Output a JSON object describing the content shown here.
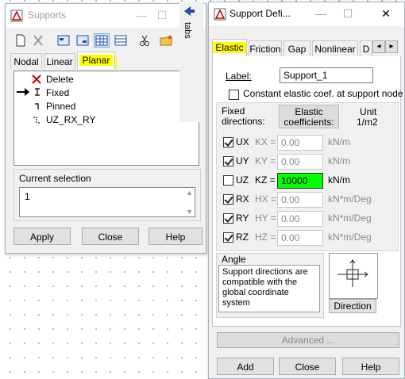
{
  "supports_window": {
    "title": "Supports",
    "minimize": "—",
    "maximize": "☐",
    "toolbar_icons": [
      "new-icon",
      "delete-icon",
      "view1-icon",
      "view2-icon",
      "table-icon",
      "grid-icon",
      "cut-icon",
      "folder-icon"
    ],
    "tabs": [
      "Nodal",
      "Linear",
      "Planar"
    ],
    "active_tab": "Planar",
    "items": [
      {
        "label": "Delete",
        "icon": "red-x-icon"
      },
      {
        "label": "Fixed",
        "icon": "fixed-support-icon"
      },
      {
        "label": "Pinned",
        "icon": "pinned-support-icon"
      },
      {
        "label": "UZ_RX_RY",
        "icon": "custom-support-icon"
      }
    ],
    "selected_index": 1,
    "current_selection_label": "Current selection",
    "current_selection_value": "1",
    "buttons": {
      "apply": "Apply",
      "close": "Close",
      "help": "Help"
    },
    "side_tab": "tabs"
  },
  "support_def_window": {
    "title": "Support Defi...",
    "minimize": "—",
    "maximize": "☐",
    "close": "✕",
    "tabs": [
      "Elastic",
      "Friction",
      "Gap",
      "Nonlinear",
      "D"
    ],
    "active_tab": "Elastic",
    "label_caption": "Label:",
    "label_value": "Support_1",
    "constant_elastic": "Constant elastic coef. at support node",
    "fixed_directions": "Fixed\ndirections:",
    "elastic_coefficients": "Elastic\ncoefficients:",
    "unit_header": "Unit",
    "unit_sub": "1/m2",
    "directions": [
      {
        "dir": "UX",
        "coef": "KX =",
        "value": "0.00",
        "unit": "kN/m",
        "checked": true,
        "enabled": false
      },
      {
        "dir": "UY",
        "coef": "KY =",
        "value": "0.00",
        "unit": "kN/m",
        "checked": true,
        "enabled": false
      },
      {
        "dir": "UZ",
        "coef": "KZ =",
        "value": "10000",
        "unit": "kN/m",
        "checked": false,
        "enabled": true
      },
      {
        "dir": "RX",
        "coef": "HX =",
        "value": "0.00",
        "unit": "kN*m/Deg",
        "checked": true,
        "enabled": false
      },
      {
        "dir": "RY",
        "coef": "HY =",
        "value": "0.00",
        "unit": "kN*m/Deg",
        "checked": true,
        "enabled": false
      },
      {
        "dir": "RZ",
        "coef": "HZ =",
        "value": "0.00",
        "unit": "kN*m/Deg",
        "checked": true,
        "enabled": false
      }
    ],
    "angle_label": "Angle",
    "angle_text": "Support directions are compatible with the global coordinate system",
    "direction_button": "Direction",
    "advanced_button": "Advanced ...",
    "buttons": {
      "add": "Add",
      "close": "Close",
      "help": "Help"
    },
    "tab_scroll_left": "◂",
    "tab_scroll_right": "▸"
  },
  "colors": {
    "highlight": "#ffff00",
    "kz_field": "#00ff00",
    "accent_blue": "#1e4fa8",
    "red": "#d00000"
  }
}
